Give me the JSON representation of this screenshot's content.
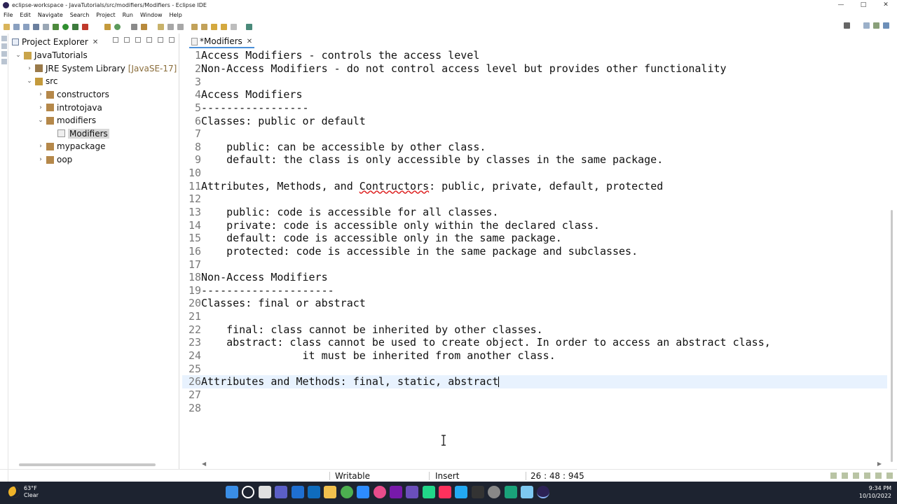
{
  "window": {
    "title": "eclipse-workspace - JavaTutorials/src/modifiers/Modifiers - Eclipse IDE",
    "controls": [
      "—",
      "□",
      "✕"
    ]
  },
  "menu": [
    "File",
    "Edit",
    "Navigate",
    "Search",
    "Project",
    "Run",
    "Window",
    "Help"
  ],
  "explorer": {
    "tab_label": "Project Explorer",
    "tab_close": "✕",
    "tree": [
      {
        "label": "JavaTutorials",
        "sub": "",
        "depth": 0,
        "expanded": true,
        "icon": "project-icon"
      },
      {
        "label": "JRE System Library",
        "sub": "[JavaSE-17]",
        "depth": 1,
        "expanded": false,
        "icon": "library-icon"
      },
      {
        "label": "src",
        "sub": "",
        "depth": 1,
        "expanded": true,
        "icon": "source-folder-icon"
      },
      {
        "label": "constructors",
        "sub": "",
        "depth": 2,
        "expanded": false,
        "icon": "package-icon"
      },
      {
        "label": "introtojava",
        "sub": "",
        "depth": 2,
        "expanded": false,
        "icon": "package-icon"
      },
      {
        "label": "modifiers",
        "sub": "",
        "depth": 2,
        "expanded": true,
        "icon": "package-icon"
      },
      {
        "label": "Modifiers",
        "sub": "",
        "depth": 3,
        "expanded": null,
        "icon": "file-icon",
        "selected": true
      },
      {
        "label": "mypackage",
        "sub": "",
        "depth": 2,
        "expanded": false,
        "icon": "package-icon"
      },
      {
        "label": "oop",
        "sub": "",
        "depth": 2,
        "expanded": false,
        "icon": "package-icon"
      }
    ]
  },
  "editor": {
    "tab_label": "*Modifiers",
    "tab_close": "✕",
    "current_line": 26,
    "lines": [
      "Access Modifiers - controls the access level",
      "Non-Access Modifiers - do not control access level but provides other functionality",
      "",
      "Access Modifiers",
      "-----------------",
      "Classes: public or default",
      "",
      "    public: can be accessible by other class.",
      "    default: the class is only accessible by classes in the same package.",
      "",
      "Attributes, Methods, and Contructors: public, private, default, protected",
      "",
      "    public: code is accessible for all classes.",
      "    private: code is accessible only within the declared class.",
      "    default: code is accessible only in the same package.",
      "    protected: code is accessible in the same package and subclasses.",
      "",
      "Non-Access Modifiers",
      "---------------------",
      "Classes: final or abstract",
      "",
      "    final: class cannot be inherited by other classes.",
      "    abstract: class cannot be used to create object. In order to access an abstract class,",
      "                it must be inherited from another class.",
      "",
      "Attributes and Methods: final, static, abstract",
      "",
      ""
    ]
  },
  "status": {
    "mode": "Writable",
    "insert": "Insert",
    "position": "26 : 48 : 945"
  },
  "taskbar": {
    "temp": "63°F",
    "weather": "Clear",
    "time": "9:34 PM",
    "date": "10/10/2022"
  },
  "colors": {
    "current_line": "#e8f2fe",
    "taskbar": "#1d2330",
    "line_numbers": "#787878"
  }
}
